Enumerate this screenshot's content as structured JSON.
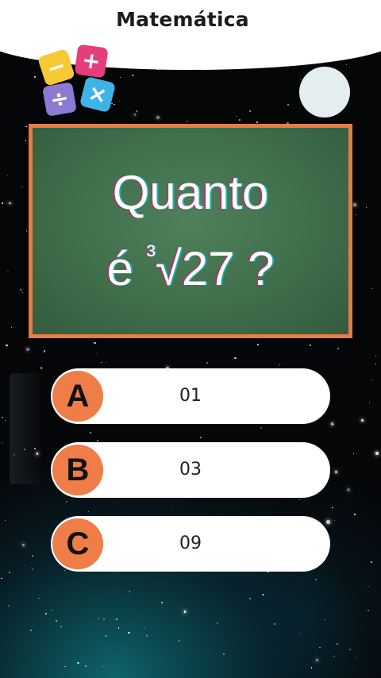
{
  "header": {
    "title": "Matemática"
  },
  "logo": {
    "icon": "math-operators-icon",
    "tiles": [
      {
        "symbol": "−",
        "color": "#f6c935"
      },
      {
        "symbol": "+",
        "color": "#e53e7a"
      },
      {
        "symbol": "÷",
        "color": "#8c7ad2"
      },
      {
        "symbol": "×",
        "color": "#3fb3e8"
      }
    ]
  },
  "question": {
    "line1": "Quanto",
    "line2_prefix": "é ",
    "line2_index": "³",
    "line2_radical": "√27 ?"
  },
  "options": [
    {
      "letter": "A",
      "text": "01"
    },
    {
      "letter": "B",
      "text": "03"
    },
    {
      "letter": "C",
      "text": "09"
    }
  ],
  "colors": {
    "accent": "#ee7d47",
    "board": "#3f6e4b",
    "board_border": "#e77b45"
  }
}
